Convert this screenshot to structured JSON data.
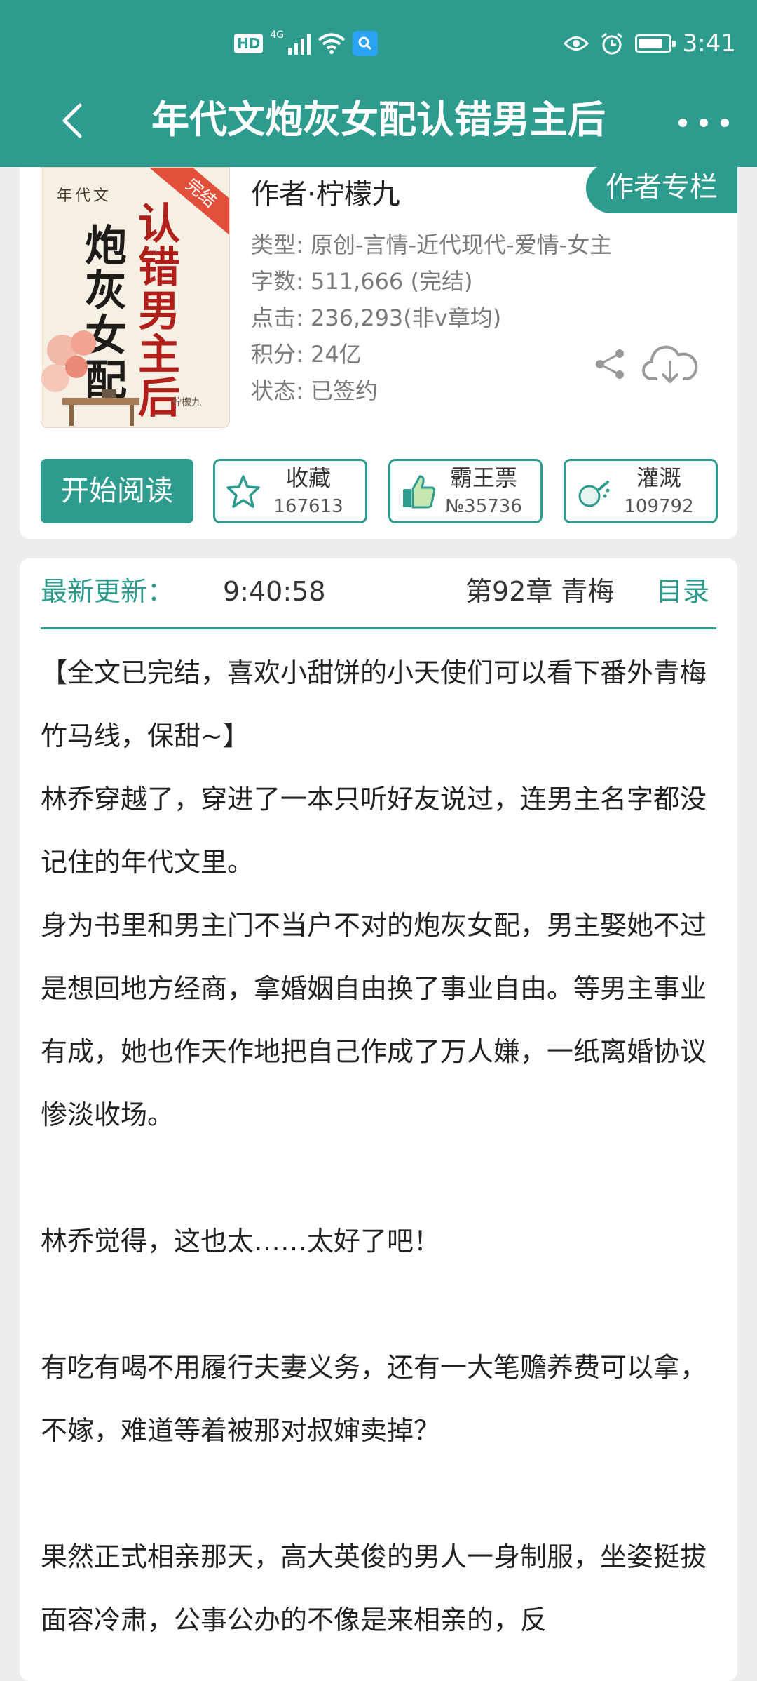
{
  "status_bar": {
    "hd": "HD",
    "network": "4G",
    "time": "3:41"
  },
  "nav": {
    "title": "年代文炮灰女配认错男主后"
  },
  "book": {
    "cover": {
      "badge": "完结",
      "series": "年代文",
      "title_red": "认错男主后",
      "title_black": "炮灰女配",
      "author_small": "柠檬九"
    },
    "author_tag": "作者专栏",
    "author": "作者·柠檬九",
    "meta": [
      "类型: 原创-言情-近代现代-爱情-女主",
      "字数: 511,666 (完结)",
      "点击: 236,293(非v章均)",
      "积分: 24亿",
      "状态: 已签约"
    ]
  },
  "actions": {
    "read": "开始阅读",
    "collect": {
      "label": "收藏",
      "count": "167613"
    },
    "ticket": {
      "label": "霸王票",
      "count": "№35736"
    },
    "water": {
      "label": "灌溉",
      "count": "109792"
    }
  },
  "update": {
    "label": "最新更新：",
    "time": "9:40:58",
    "chapter": "第92章  青梅",
    "toc": "目录"
  },
  "description": [
    "【全文已完结，喜欢小甜饼的小天使们可以看下番外青梅竹马线，保甜~】",
    "林乔穿越了，穿进了一本只听好友说过，连男主名字都没记住的年代文里。",
    "身为书里和男主门不当户不对的炮灰女配，男主娶她不过是想回地方经商，拿婚姻自由换了事业自由。等男主事业有成，她也作天作地把自己作成了万人嫌，一纸离婚协议惨淡收场。",
    "",
    "林乔觉得，这也太……太好了吧！",
    "",
    "有吃有喝不用履行夫妻义务，还有一大笔赡养费可以拿，不嫁，难道等着被那对叔婶卖掉？",
    "",
    "果然正式相亲那天，高大英俊的男人一身制服，坐姿挺拔面容冷肃，公事公办的不像是来相亲的，反"
  ],
  "colors": {
    "brand": "#2d9b8d",
    "background": "#ededed",
    "card": "#ffffff"
  }
}
